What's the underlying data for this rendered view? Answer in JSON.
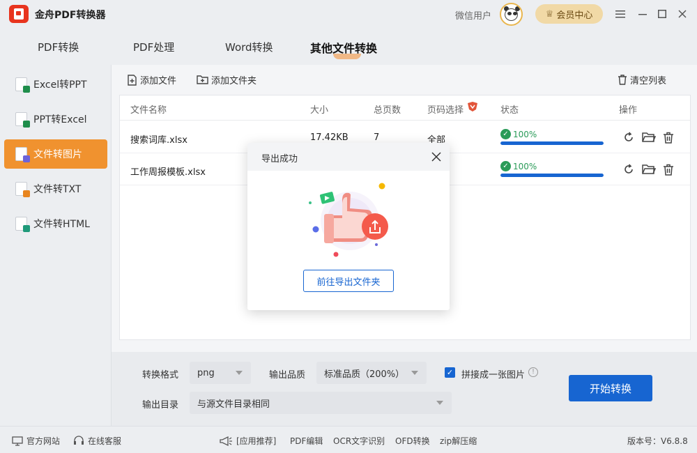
{
  "app": {
    "title": "金舟PDF转换器",
    "user_name": "微信用户",
    "vip_label": "会员中心"
  },
  "tabs": [
    {
      "label": "PDF转换",
      "active": false
    },
    {
      "label": "PDF处理",
      "active": false
    },
    {
      "label": "Word转换",
      "active": false
    },
    {
      "label": "其他文件转换",
      "active": true
    }
  ],
  "sidebar": {
    "items": [
      {
        "label": "Excel转PPT",
        "active": false,
        "icon": "excel-to-ppt-icon"
      },
      {
        "label": "PPT转Excel",
        "active": false,
        "icon": "ppt-to-excel-icon"
      },
      {
        "label": "文件转图片",
        "active": true,
        "icon": "file-to-image-icon"
      },
      {
        "label": "文件转TXT",
        "active": false,
        "icon": "file-to-txt-icon"
      },
      {
        "label": "文件转HTML",
        "active": false,
        "icon": "file-to-html-icon"
      }
    ]
  },
  "toolbar": {
    "add_file": "添加文件",
    "add_folder": "添加文件夹",
    "clear_list": "清空列表"
  },
  "table": {
    "headers": {
      "name": "文件名称",
      "size": "大小",
      "pages": "总页数",
      "page_select": "页码选择",
      "status": "状态",
      "actions": "操作"
    },
    "rows": [
      {
        "name": "搜索词库.xlsx",
        "size": "17.42KB",
        "pages": "7",
        "page_select": "全部",
        "progress_label": "100%",
        "progress": 1.0
      },
      {
        "name": "工作周报模板.xlsx",
        "size": "",
        "pages": "",
        "page_select": "",
        "progress_label": "100%",
        "progress": 1.0
      }
    ]
  },
  "settings": {
    "format_label": "转换格式",
    "format_value": "png",
    "quality_label": "输出品质",
    "quality_value": "标准品质（200%）",
    "merge_label": "拼接成一张图片",
    "merge_checked": true,
    "output_dir_label": "输出目录",
    "output_dir_value": "与源文件目录相同",
    "start_button": "开始转换"
  },
  "footer": {
    "website": "官方网站",
    "support": "在线客服",
    "recommend": "[应用推荐]",
    "links": [
      "PDF编辑",
      "OCR文字识别",
      "OFD转换",
      "zip解压缩"
    ],
    "version": "版本号：V6.8.8"
  },
  "modal": {
    "title": "导出成功",
    "button": "前往导出文件夹"
  },
  "colors": {
    "accent_orange": "#f0922f",
    "primary_blue": "#1765d1",
    "success_green": "#2a9b58",
    "vip_gold": "#f1d9a6"
  }
}
